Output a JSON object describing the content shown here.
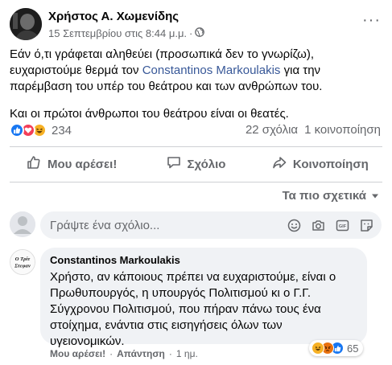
{
  "post": {
    "author": "Χρήστος Α. Χωμενίδης",
    "date": "15 Σεπτεμβρίου στις 8:44 μ.μ.",
    "separator": "·",
    "more": "···",
    "body_line1_before": "Εάν ό,τι γράφεται αληθεύει (προσωπικά δεν το γνωρίζω), ευχαριστούμε θερμά τον ",
    "mention": "Constantinos Markoulakis",
    "body_line1_after": " για την παρέμβαση του υπέρ του θεάτρου και των ανθρώπων του.",
    "body_paragraph2": "Και οι πρώτοι άνθρωποι του θεάτρου είναι οι θεατές."
  },
  "reactions": {
    "count": "234",
    "icons": [
      "like-icon",
      "love-icon",
      "haha-icon"
    ]
  },
  "stats": {
    "comments": "22 σχόλια",
    "shares": "1 κοινοποίηση"
  },
  "actions": {
    "like": "Μου αρέσει!",
    "comment": "Σχόλιο",
    "share": "Κοινοποίηση"
  },
  "sort": {
    "label": "Τα πιο σχετικά"
  },
  "composer": {
    "placeholder": "Γράψτε ένα σχόλιο...",
    "icons": [
      "emoji-icon",
      "camera-icon",
      "gif-icon",
      "sticker-icon"
    ]
  },
  "comment": {
    "author": "Constantinos Markoulakis",
    "avatar_text": [
      "Ο Τρίτ",
      "Στεφαν"
    ],
    "text": "Χρήστο, αν κάποιους πρέπει να ευχαριστούμε, είναι ο Πρωθυπουργός, η υπουργός Πολιτισμού κι ο Γ.Γ. Σύγχρονου Πολιτισμού, που πήραν πάνω τους ένα στοίχημα, ενάντια στις εισηγήσεις όλων των υγειονομικών.",
    "reaction_count": "65",
    "like": "Μου αρέσει!",
    "reply": "Απάντηση",
    "time": "1 ημ.",
    "separator": "·"
  },
  "colors": {
    "like": "#1877f2",
    "love": "#f33e58",
    "haha": "#f7b125",
    "angry": "#e9710f",
    "text_secondary": "#65676b",
    "mention": "#385898"
  }
}
